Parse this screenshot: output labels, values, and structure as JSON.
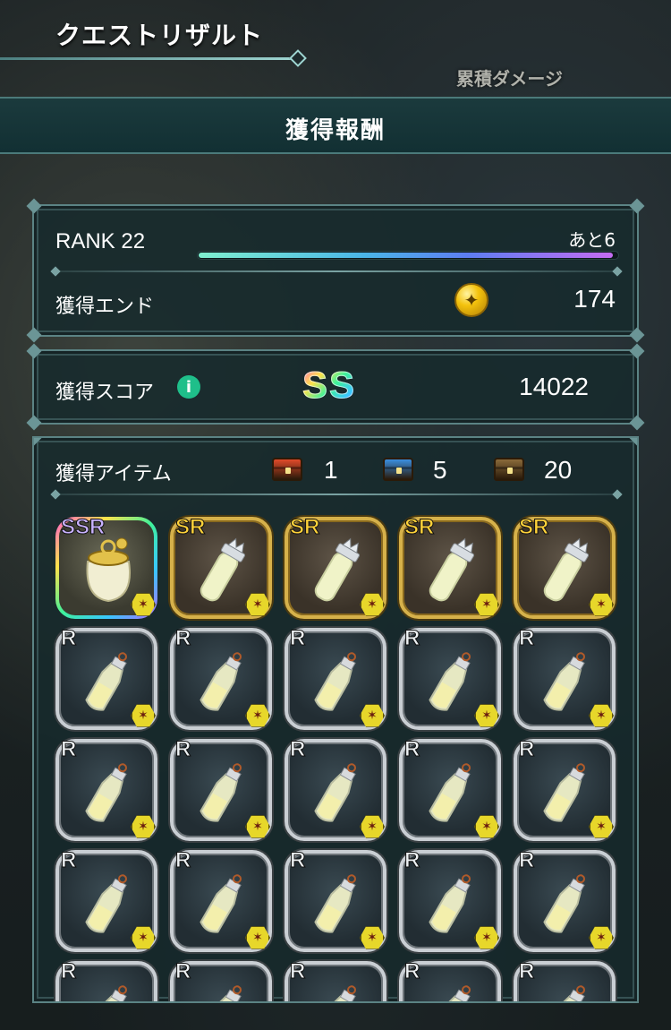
{
  "header": {
    "title": "クエストリザルト",
    "damage_label": "累積ダメージ"
  },
  "reward": {
    "title": "獲得報酬"
  },
  "rank": {
    "label": "RANK 22",
    "remaining": "あと6",
    "progress": 0.99
  },
  "end": {
    "label": "獲得エンド",
    "value": "174",
    "coin_icon": "coin-icon"
  },
  "score": {
    "label": "獲得スコア",
    "info_icon": "info-icon",
    "grade": "SS",
    "value": "14022"
  },
  "items": {
    "label": "獲得アイテム",
    "chests": [
      {
        "name": "red-chest-icon",
        "count": "1",
        "color": "#e04a2a"
      },
      {
        "name": "blue-chest-icon",
        "count": "5",
        "color": "#3a8fe0"
      },
      {
        "name": "brown-chest-icon",
        "count": "20",
        "color": "#8a6a3a"
      }
    ],
    "grid": [
      {
        "rarity": "SSR",
        "art": "gold-pouch-icon"
      },
      {
        "rarity": "SR",
        "art": "crystal-vial-icon"
      },
      {
        "rarity": "SR",
        "art": "crystal-vial-icon"
      },
      {
        "rarity": "SR",
        "art": "crystal-vial-icon"
      },
      {
        "rarity": "SR",
        "art": "crystal-vial-icon"
      },
      {
        "rarity": "R",
        "art": "potion-bottle-icon"
      },
      {
        "rarity": "R",
        "art": "potion-bottle-icon"
      },
      {
        "rarity": "R",
        "art": "potion-bottle-icon"
      },
      {
        "rarity": "R",
        "art": "potion-bottle-icon"
      },
      {
        "rarity": "R",
        "art": "potion-bottle-icon"
      },
      {
        "rarity": "R",
        "art": "potion-bottle-icon"
      },
      {
        "rarity": "R",
        "art": "potion-bottle-icon"
      },
      {
        "rarity": "R",
        "art": "potion-bottle-icon"
      },
      {
        "rarity": "R",
        "art": "potion-bottle-icon"
      },
      {
        "rarity": "R",
        "art": "potion-bottle-icon"
      },
      {
        "rarity": "R",
        "art": "potion-bottle-icon"
      },
      {
        "rarity": "R",
        "art": "potion-bottle-icon"
      },
      {
        "rarity": "R",
        "art": "potion-bottle-icon"
      },
      {
        "rarity": "R",
        "art": "potion-bottle-icon"
      },
      {
        "rarity": "R",
        "art": "potion-bottle-icon"
      },
      {
        "rarity": "R",
        "art": "potion-bottle-icon"
      },
      {
        "rarity": "R",
        "art": "potion-bottle-icon"
      },
      {
        "rarity": "R",
        "art": "potion-bottle-icon"
      },
      {
        "rarity": "R",
        "art": "potion-bottle-icon"
      },
      {
        "rarity": "R",
        "art": "potion-bottle-icon"
      }
    ]
  }
}
